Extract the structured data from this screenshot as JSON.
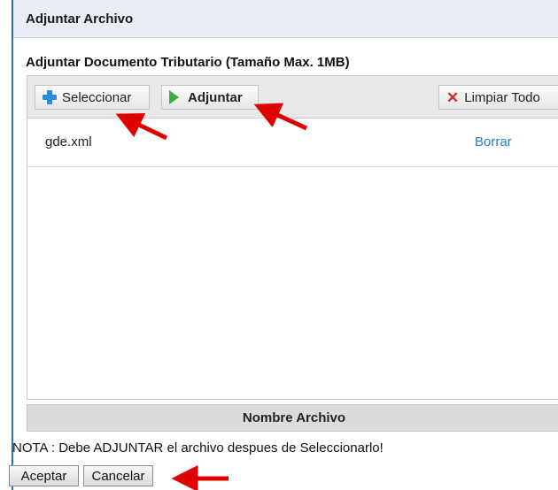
{
  "dialog": {
    "title": "Adjuntar Archivo"
  },
  "upload": {
    "section_title": "Adjuntar Documento Tributario (Tamaño Max. 1MB)",
    "toolbar": {
      "select_label": "Seleccionar",
      "attach_label": "Adjuntar",
      "clear_label": "Limpiar Todo"
    },
    "files": [
      {
        "name": "gde.xml",
        "action": "Borrar"
      }
    ],
    "column_header": "Nombre Archivo"
  },
  "note": "NOTA : Debe ADJUNTAR el archivo despues de Seleccionarlo!",
  "buttons": {
    "accept": "Aceptar",
    "cancel": "Cancelar"
  },
  "colors": {
    "accent": "#2f6fb0",
    "link": "#2a7cc8",
    "annotation_arrow": "#e00000"
  },
  "icons": {
    "select": "plus-icon",
    "attach": "play-icon",
    "clear": "x-icon"
  }
}
